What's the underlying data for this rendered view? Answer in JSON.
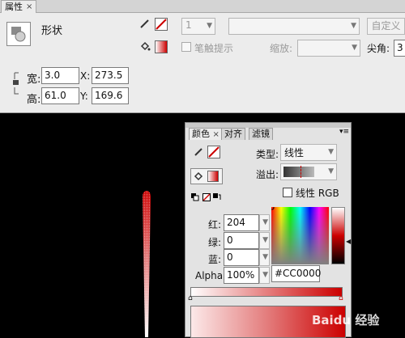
{
  "properties_panel": {
    "tab_title": "属性",
    "tab_close": "×",
    "object_type": "形状",
    "width_label": "宽:",
    "width_value": "3.0",
    "height_label": "高:",
    "height_value": "61.0",
    "x_label": "X:",
    "x_value": "273.5",
    "y_label": "Y:",
    "y_value": "169.6",
    "stroke_size_value": "1",
    "stroke_hint_checkbox": "笔触提示",
    "scale_label": "缩放:",
    "cap_label": "尖角:",
    "cap_value": "3",
    "custom_button": "自定义"
  },
  "color_panel": {
    "tabs": [
      "颜色",
      "对齐",
      "滤镜"
    ],
    "tab_close": "×",
    "type_label": "类型:",
    "type_value": "线性",
    "overflow_label": "溢出:",
    "linear_rgb_checkbox": "线性 RGB",
    "red_label": "红:",
    "red_value": "204",
    "green_label": "绿:",
    "green_value": "0",
    "blue_label": "蓝:",
    "blue_value": "0",
    "alpha_label": "Alpha:",
    "alpha_value": "100%",
    "hex_value": "#CC0000",
    "colors": {
      "selected": "#CC0000"
    }
  },
  "watermark": "Baidu 经验"
}
